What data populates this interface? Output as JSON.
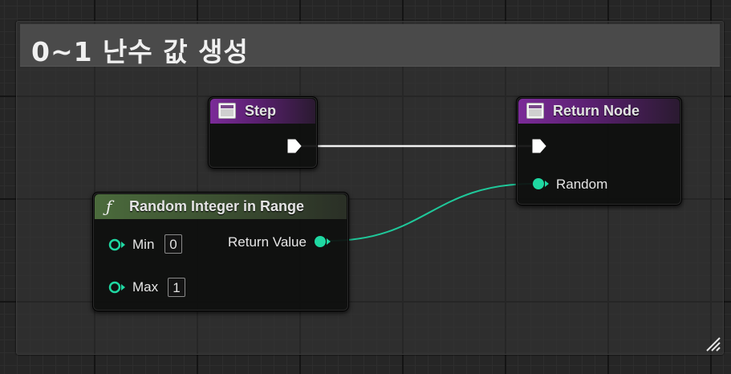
{
  "comment": {
    "title": "0~1  난수 값 생성"
  },
  "nodes": {
    "step": {
      "title": "Step"
    },
    "return_node": {
      "title": "Return Node",
      "pin_random": "Random"
    },
    "random_integer": {
      "title": "Random Integer in Range",
      "pin_min": "Min",
      "min_value": "0",
      "pin_max": "Max",
      "max_value": "1",
      "pin_return": "Return Value"
    }
  },
  "colors": {
    "function_header": "#4b6b3c",
    "event_header": "#7b2b98",
    "integer_pin": "#1fd8a2",
    "exec_wire": "#ffffff"
  },
  "icons": [
    "function-icon",
    "node-icon",
    "exec-pin-icon",
    "data-pin-icon",
    "resize-grip-icon"
  ]
}
